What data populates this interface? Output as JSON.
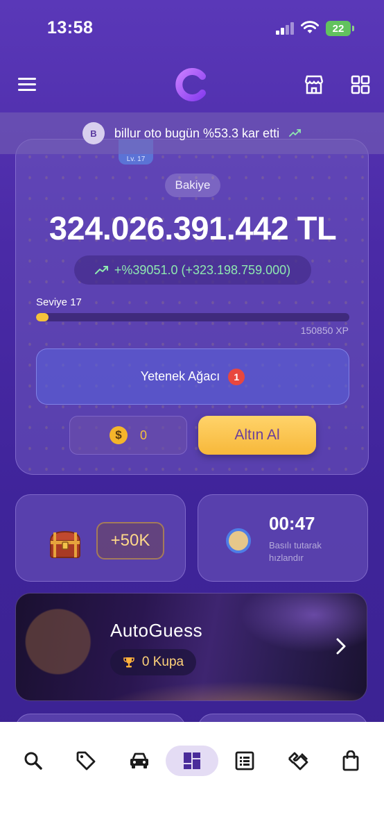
{
  "status_bar": {
    "time": "13:58",
    "battery": "22"
  },
  "ticker": {
    "avatar_initial": "B",
    "text": "billur oto bugün %53.3 kar etti"
  },
  "balance_card": {
    "level_tab": "Lv. 17",
    "label": "Bakiye",
    "amount": "324.026.391.442 TL",
    "change": "+%39051.0 (+323.198.759.000)",
    "level_label": "Seviye 17",
    "level_progress": 0.04,
    "xp": "150850 XP",
    "skill_tree_label": "Yetenek Ağacı",
    "skill_tree_badge": "1",
    "coins": "0",
    "buy_gold_label": "Altın Al"
  },
  "chest_card": {
    "bonus": "+50K"
  },
  "timer_card": {
    "time": "00:47",
    "hint": "Basılı tutarak hızlandır"
  },
  "autoguess": {
    "title": "AutoGuess",
    "trophies": "0 Kupa"
  },
  "bottom_nav": {
    "items": [
      "search-icon",
      "tag-icon",
      "car-icon",
      "dashboard-icon",
      "list-icon",
      "handshake-icon",
      "bag-icon"
    ],
    "active_index": 3
  },
  "colors": {
    "accent_gold": "#f5c23b",
    "positive": "#8ee8b0",
    "badge_red": "#e8473f",
    "nav_active": "#e4dcf4"
  }
}
